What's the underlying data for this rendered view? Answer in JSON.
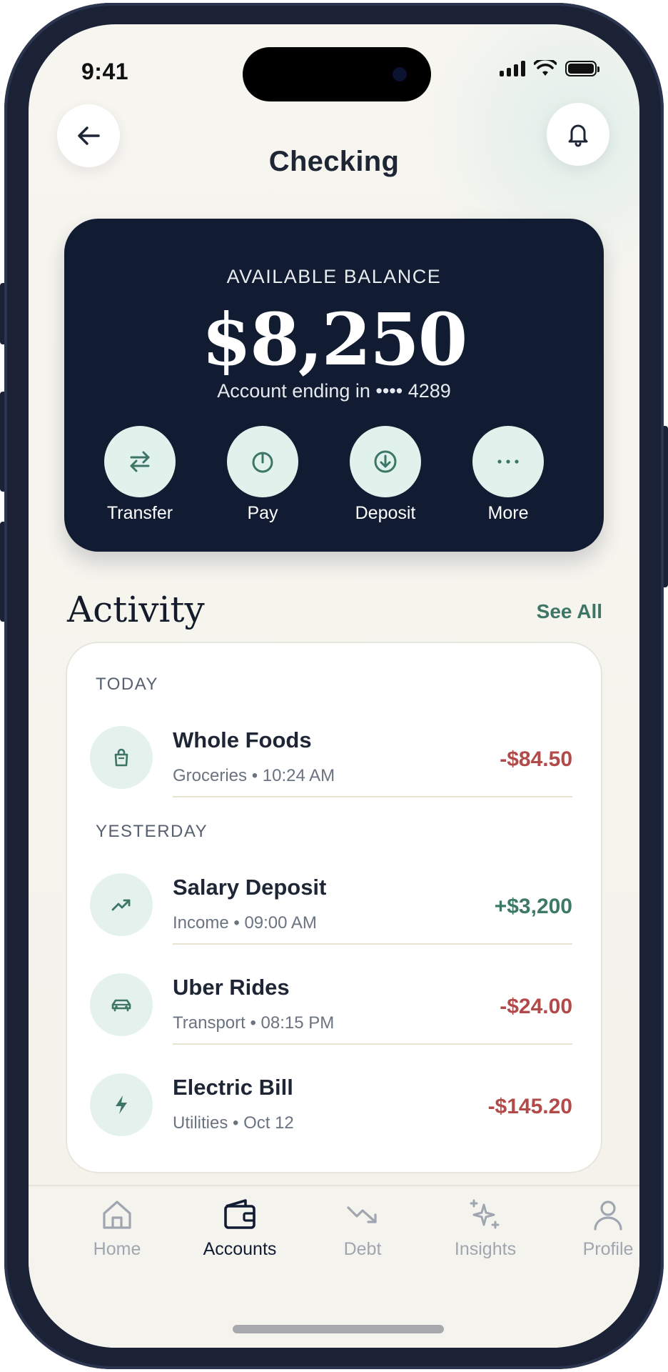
{
  "status_bar": {
    "time": "9:41"
  },
  "header": {
    "title": "Checking",
    "back_icon": "arrow-left-icon",
    "bell_icon": "bell-icon"
  },
  "balance": {
    "label": "AVAILABLE BALANCE",
    "amount": "$8,250",
    "account": "Account ending in •••• 4289",
    "actions": [
      {
        "label": "Transfer",
        "icon": "transfer-arrows-icon"
      },
      {
        "label": "Pay",
        "icon": "power-icon"
      },
      {
        "label": "Deposit",
        "icon": "download-circle-icon"
      },
      {
        "label": "More",
        "icon": "more-dots-icon"
      }
    ]
  },
  "activity": {
    "title": "Activity",
    "see_all": "See All",
    "sections": [
      {
        "label": "TODAY"
      },
      {
        "label": "YESTERDAY"
      }
    ],
    "transactions": [
      {
        "name": "Whole Foods",
        "sub": "Groceries • 10:24 AM",
        "amount": "-$84.50",
        "icon": "shopping-bag-icon"
      },
      {
        "name": "Salary Deposit",
        "sub": "Income • 09:00 AM",
        "amount": "+$3,200",
        "icon": "trending-up-icon"
      },
      {
        "name": "Uber Rides",
        "sub": "Transport • 08:15 PM",
        "amount": "-$24.00",
        "icon": "car-icon"
      },
      {
        "name": "Electric Bill",
        "sub": "Utilities • Oct 12",
        "amount": "-$145.20",
        "icon": "lightning-icon"
      }
    ]
  },
  "tabbar": {
    "tabs": [
      {
        "label": "Home",
        "icon": "home-icon"
      },
      {
        "label": "Accounts",
        "icon": "wallet-icon",
        "active": true
      },
      {
        "label": "Debt",
        "icon": "trending-down-icon"
      },
      {
        "label": "Insights",
        "icon": "sparkles-icon"
      },
      {
        "label": "Profile",
        "icon": "user-icon"
      }
    ]
  },
  "colors": {
    "card_dark": "#111c33",
    "accent_mint": "#e1f2ec",
    "accent_green": "#3d7566",
    "negative": "#b24a4a",
    "positive": "#3c7a64",
    "background": "#f6f5f0"
  }
}
